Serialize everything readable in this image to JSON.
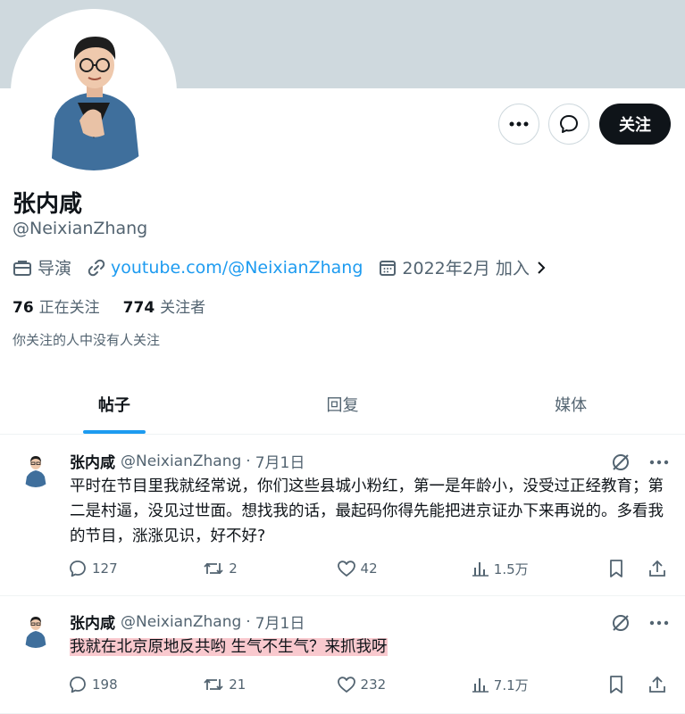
{
  "profile": {
    "name": "张内咸",
    "handle": "@NeixianZhang",
    "profession": "导演",
    "link": "youtube.com/@NeixianZhang",
    "joined": "2022年2月 加入",
    "following_count": "76",
    "following_label": "正在关注",
    "followers_count": "774",
    "followers_label": "关注者",
    "mutual_note": "你关注的人中没有人关注"
  },
  "actions": {
    "more_icon": "more-icon",
    "message_icon": "message-icon",
    "follow_label": "关注"
  },
  "tabs": [
    {
      "label": "帖子",
      "active": true
    },
    {
      "label": "回复",
      "active": false
    },
    {
      "label": "媒体",
      "active": false
    }
  ],
  "posts": [
    {
      "name": "张内咸",
      "handle": "@NeixianZhang",
      "separator": "·",
      "date": "7月1日",
      "text": "平时在节目里我就经常说，你们这些县城小粉红，第一是年龄小，没受过正经教育；第二是村逼，没见过世面。想找我的话，最起码你得先能把进京证办下来再说的。多看我的节目，涨涨见识，好不好?",
      "replies": "127",
      "reposts": "2",
      "likes": "42",
      "views": "1.5万"
    },
    {
      "name": "张内咸",
      "handle": "@NeixianZhang",
      "separator": "·",
      "date": "7月1日",
      "text": "我就在北京原地反共哟 生气不生气？来抓我呀",
      "replies": "198",
      "reposts": "21",
      "likes": "232",
      "views": "7.1万"
    }
  ],
  "colors": {
    "accent": "#1d9bf0",
    "highlight": "#f9c9ce",
    "banner": "#cfd9de"
  }
}
